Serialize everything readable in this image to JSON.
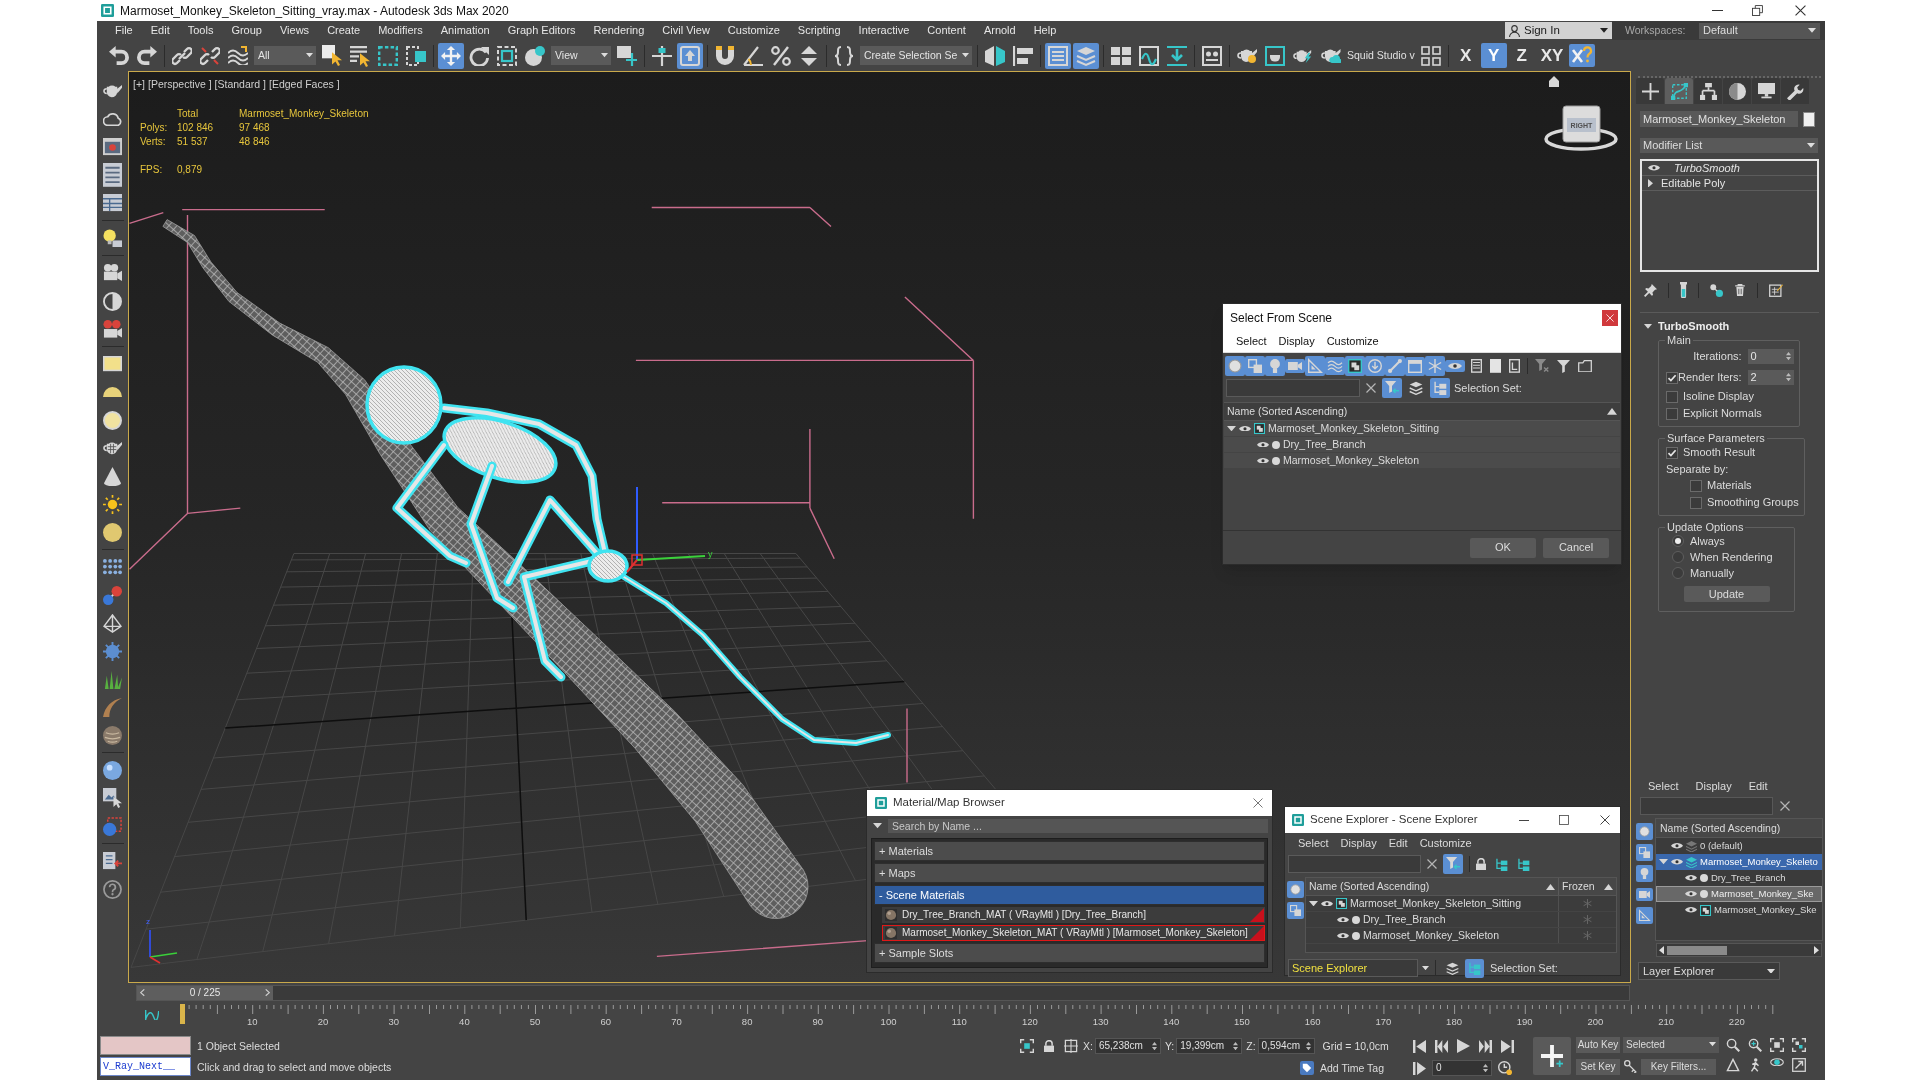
{
  "window": {
    "title": "Marmoset_Monkey_Skeleton_Sitting_vray.max - Autodesk 3ds Max 2020"
  },
  "menu_bar": {
    "items": [
      "File",
      "Edit",
      "Tools",
      "Group",
      "Views",
      "Create",
      "Modifiers",
      "Animation",
      "Graph Editors",
      "Rendering",
      "Civil View",
      "Customize",
      "Scripting",
      "Interactive",
      "Content",
      "Arnold",
      "Help"
    ],
    "sign_in": "Sign In",
    "workspaces_label": "Workspaces:",
    "workspace": "Default"
  },
  "main_toolbar": {
    "tools": [
      {
        "selected": false
      },
      {
        "selected": false
      },
      {
        "selected": false
      },
      {
        "selected": false
      },
      {
        "selected": false
      },
      {
        "selected": false
      },
      {
        "selected": false
      },
      {
        "selected": false
      },
      {
        "selected": false
      },
      {
        "selected": true
      },
      {
        "selected": false
      },
      {
        "selected": false
      },
      {
        "selected": false
      },
      {
        "selected": false
      },
      {
        "selected": false
      },
      {
        "selected": true
      },
      {
        "selected": false
      },
      {
        "selected": false
      },
      {
        "selected": false
      },
      {
        "selected": false
      },
      {
        "selected": false
      },
      {
        "selected": false
      },
      {
        "selected": false
      },
      {
        "selected": true
      },
      {
        "selected": true
      },
      {
        "selected": false
      },
      {
        "selected": false
      },
      {
        "selected": false
      },
      {
        "selected": false
      },
      {
        "selected": false
      },
      {
        "selected": false
      },
      {
        "selected": false
      },
      {
        "selected": false
      },
      {
        "selected": false
      },
      {
        "selected": true
      }
    ],
    "selection_filter": "All",
    "reference_coordinate_system": "View",
    "named_selection_set": "Create Selection Se",
    "script_label": "Squid Studio v",
    "axis_constraints": [
      {
        "label": "X",
        "selected": false
      },
      {
        "label": "Y",
        "selected": true
      },
      {
        "label": "Z",
        "selected": false
      },
      {
        "label": "XY",
        "selected": false
      }
    ]
  },
  "viewport": {
    "labels": [
      "[+]",
      "[Perspective ]",
      "[Standard ]",
      "[Edged Faces ]"
    ],
    "stats": {
      "columns": [
        "Total",
        "Marmoset_Monkey_Skeleton"
      ],
      "rows": [
        {
          "label": "Polys:",
          "values": [
            "102 846",
            "97 468"
          ]
        },
        {
          "label": "Verts:",
          "values": [
            "51 537",
            "48 846"
          ]
        }
      ],
      "fps_label": "FPS:",
      "fps": "0,879"
    },
    "viewcube_face": "RIGHT",
    "gizmo_label": "y",
    "tripod_label": "z"
  },
  "command_panel": {
    "tabs": [
      {
        "selected": false
      },
      {
        "selected": true
      },
      {
        "selected": false
      },
      {
        "selected": false
      },
      {
        "selected": false
      },
      {
        "selected": false
      }
    ],
    "object_name": "Marmoset_Monkey_Skeleton",
    "modifier_list": "Modifier List",
    "modifier_stack": [
      {
        "label": "TurboSmooth",
        "kind": "modifier"
      },
      {
        "label": "Editable Poly",
        "kind": "base"
      }
    ],
    "rollout": {
      "title": "TurboSmooth",
      "expanded": true,
      "groups": [
        {
          "title": "Main",
          "controls": [
            {
              "kind": "spinner",
              "label": "Iterations:",
              "value": "0"
            },
            {
              "kind": "spinner",
              "label": "Render Iters:",
              "checked": true,
              "value": "2"
            },
            {
              "kind": "checkbox",
              "label": "Isoline Display",
              "checked": false
            },
            {
              "kind": "checkbox",
              "label": "Explicit Normals",
              "checked": false
            }
          ]
        },
        {
          "title": "Surface Parameters",
          "controls": [
            {
              "kind": "checkbox",
              "label": "Smooth Result",
              "checked": true
            },
            {
              "kind": "label",
              "label": "Separate by:",
              "children": [
                {
                  "kind": "checkbox",
                  "label": "Materials",
                  "checked": false
                },
                {
                  "kind": "checkbox",
                  "label": "Smoothing Groups",
                  "checked": false
                }
              ]
            }
          ]
        },
        {
          "title": "Update Options",
          "controls": [
            {
              "kind": "radio",
              "label": "Always",
              "selected": true
            },
            {
              "kind": "radio",
              "label": "When Rendering",
              "selected": false
            },
            {
              "kind": "radio",
              "label": "Manually",
              "selected": false
            },
            {
              "kind": "button",
              "label": "Update"
            }
          ]
        }
      ]
    }
  },
  "layer_explorer": {
    "menu": [
      "Select",
      "Display",
      "Edit"
    ],
    "filters": [
      {
        "on": true
      },
      {
        "on": true
      },
      {
        "on": true
      },
      {
        "on": true
      },
      {
        "on": true
      }
    ],
    "column": "Name (Sorted Ascending)",
    "rows": [
      {
        "label": "0 (default)",
        "kind": "layer",
        "selected": false,
        "highlighted": false
      },
      {
        "label": "Marmoset_Monkey_Skeleto",
        "kind": "layer",
        "selected": true,
        "highlighted": false,
        "expanded": true,
        "children": [
          {
            "label": "Dry_Tree_Branch",
            "kind": "object",
            "selected": false,
            "highlighted": false
          },
          {
            "label": "Marmoset_Monkey_Ske",
            "kind": "object",
            "selected": false,
            "highlighted": true
          },
          {
            "label": "Marmoset_Monkey_Ske",
            "kind": "group",
            "selected": false,
            "highlighted": false
          }
        ]
      }
    ],
    "footer": "Layer Explorer"
  },
  "timeline": {
    "slider_label": "0 / 225",
    "level": 0,
    "frame_labels": [
      "10",
      "20",
      "30",
      "40",
      "50",
      "60",
      "70",
      "80",
      "90",
      "100",
      "110",
      "120",
      "130",
      "140",
      "150",
      "160",
      "170",
      "180",
      "190",
      "200",
      "210",
      "220"
    ]
  },
  "status_bar": {
    "listener": "V_Ray_Next__",
    "selection_info": "1 Object Selected",
    "prompt": "Click and drag to select and move objects",
    "coordinates": [
      {
        "label": "X:",
        "value": "65,238cm"
      },
      {
        "label": "Y:",
        "value": "19,399cm"
      },
      {
        "label": "Z:",
        "value": "0,594cm"
      }
    ],
    "grid": "Grid = 10,0cm",
    "add_time_tag": "Add Time Tag",
    "current_frame": "0",
    "auto_key": "Auto Key",
    "set_key": "Set Key",
    "key_mode": "Selected",
    "key_filters": "Key Filters..."
  },
  "select_from_scene": {
    "title": "Select From Scene",
    "menu": [
      "Select",
      "Display",
      "Customize"
    ],
    "filters": [
      {
        "on": true
      },
      {
        "on": true
      },
      {
        "on": true
      },
      {
        "on": true
      },
      {
        "on": true
      },
      {
        "on": true
      },
      {
        "on": true
      },
      {
        "on": true
      },
      {
        "on": true
      },
      {
        "on": true
      },
      {
        "on": true
      },
      {
        "on": true
      }
    ],
    "toggles": [
      {
        "on": true
      },
      {
        "on": false
      },
      {
        "on": true
      }
    ],
    "selection_set_label": "Selection Set:",
    "column": "Name (Sorted Ascending)",
    "rows": [
      {
        "label": "Marmoset_Monkey_Skeleton_Sitting",
        "kind": "group",
        "expanded": true,
        "children": [
          {
            "label": "Dry_Tree_Branch",
            "kind": "object"
          },
          {
            "label": "Marmoset_Monkey_Skeleton",
            "kind": "object"
          }
        ]
      }
    ],
    "buttons": [
      "OK",
      "Cancel"
    ]
  },
  "material_browser": {
    "title": "Material/Map Browser",
    "search_placeholder": "Search by Name ...",
    "sections": [
      {
        "label": "+ Materials",
        "selected": false
      },
      {
        "label": "+ Maps",
        "selected": false
      },
      {
        "label": "- Scene Materials",
        "selected": true,
        "children": [
          {
            "label": "Dry_Tree_Branch_MAT ( VRayMtl ) [Dry_Tree_Branch]",
            "selected": false
          },
          {
            "label": "Marmoset_Monkey_Skeleton_MAT ( VRayMtl ) [Marmoset_Monkey_Skeleton]",
            "selected": true
          }
        ]
      },
      {
        "label": "+ Sample Slots",
        "selected": false
      }
    ]
  },
  "scene_explorer": {
    "title": "Scene Explorer - Scene Explorer",
    "menu": [
      "Select",
      "Display",
      "Edit",
      "Customize"
    ],
    "toggles": [
      {
        "on": true
      }
    ],
    "filters": [
      {
        "on": true
      },
      {
        "on": true
      }
    ],
    "columns": [
      "Name (Sorted Ascending)",
      "Frozen"
    ],
    "rows": [
      {
        "label": "Marmoset_Monkey_Skeleton_Sitting",
        "kind": "group",
        "expanded": true,
        "frozen": false,
        "children": [
          {
            "label": "Dry_Tree_Branch",
            "kind": "object",
            "frozen": false
          },
          {
            "label": "Marmoset_Monkey_Skeleton",
            "kind": "object",
            "frozen": false
          }
        ]
      }
    ],
    "explorer": "Scene Explorer",
    "footer_toggles": [
      {
        "on": false
      },
      {
        "on": true
      }
    ],
    "selection_set_label": "Selection Set:"
  }
}
